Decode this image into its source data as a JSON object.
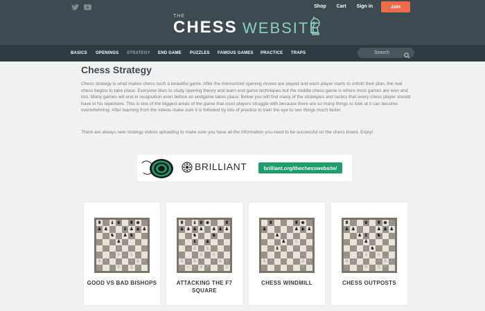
{
  "header": {
    "social": [
      {
        "name": "twitter-icon"
      },
      {
        "name": "youtube-icon"
      }
    ],
    "nav": {
      "shop": "Shop",
      "cart": "Cart",
      "sign_in": "Sign in",
      "join": "Join"
    },
    "logo": {
      "the": "THE",
      "chess": "CHESS",
      "web": "WEBSITE"
    }
  },
  "navbar": {
    "items": [
      "BASICS",
      "OPENINGS",
      "STRATEGY",
      "END GAME",
      "PUZZLES",
      "FAMOUS GAMES",
      "PRACTICE",
      "TRAPS"
    ],
    "active": "STRATEGY",
    "search_placeholder": "Search"
  },
  "main": {
    "title": "Chess Strategy",
    "paragraph1": "Chess strategy is what makes chess such a beautiful game. After the memorized opening moves are played and each player starts to unfold their plan, the real chess begins to take place. Everyone likes to study opening theory and learn end game techniques but the middle chess game is where most games are won and lost. Many games will end in resignation even before an endgame takes place. Below you will find many of the strategies and tactics that every chess player should have in his repertoire. This is one of the biggest areas of the game that most players struggle with because there are so many things to look at it can become overwhelming. After learning from the videos make sure it is followed by lots of practice to train the eye to see things much faster.",
    "paragraph2": "There are always new strategy videos uploading to make sure you have all the information you need to be successful on the chess board. Enjoy!"
  },
  "banner": {
    "brand": "BRILLIANT",
    "cta": "brilliant.org/thechesswebsite/"
  },
  "cards": [
    {
      "caption": "GOOD VS BAD BISHOPS"
    },
    {
      "caption": "ATTACKING THE F7 SQUARE"
    },
    {
      "caption": "CHESS WINDMILL"
    },
    {
      "caption": "CHESS OUTPOSTS"
    }
  ],
  "colors": {
    "header_bg": "#3d4a52",
    "navbar_bg": "#2f3b42",
    "join_bg": "#ef6b4a",
    "logo_accent": "#8bd0c1",
    "banner_cta": "#1e9e6b"
  }
}
